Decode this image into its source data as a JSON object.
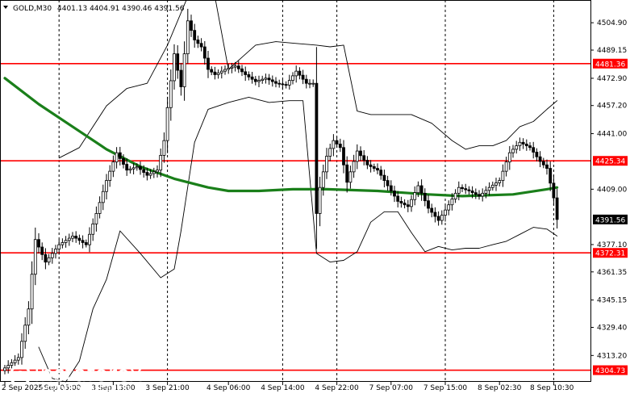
{
  "header": {
    "symbol": "GOLD,M30",
    "ohlc": "4401.13 4404.91 4390.46 4391.56"
  },
  "colors": {
    "background": "#ffffff",
    "candle": "#000000",
    "ma": "#1a7f1a",
    "envelope": "#000000",
    "level_line": "#ff0000",
    "level_tag_bg": "#ff0000",
    "level_tag_text": "#ffffff",
    "current_tag_bg": "#000000",
    "current_tag_text": "#ffffff",
    "grid_dashed": "#000000",
    "axis_text": "#000000"
  },
  "watermark": {
    "brand": "instaforex",
    "tagline": "Instant Forex Trading"
  },
  "chart_data": {
    "type": "candlestick",
    "title": "GOLD,M30",
    "ylim": [
      4298,
      4518
    ],
    "y_ticks": [
      4504.9,
      4489.15,
      4472.9,
      4457.2,
      4441.0,
      4409.0,
      4377.1,
      4361.35,
      4345.15,
      4329.4,
      4313.2
    ],
    "x_labels": [
      {
        "label": "2 Sep 2025",
        "index": 0
      },
      {
        "label": "3 Sep 05:00",
        "index": 16
      },
      {
        "label": "3 Sep 13:00",
        "index": 32
      },
      {
        "label": "3 Sep 21:00",
        "index": 48
      },
      {
        "label": "4 Sep 06:00",
        "index": 66
      },
      {
        "label": "4 Sep 14:00",
        "index": 82
      },
      {
        "label": "4 Sep 22:00",
        "index": 98
      },
      {
        "label": "7 Sep 07:00",
        "index": 114
      },
      {
        "label": "7 Sep 15:00",
        "index": 130
      },
      {
        "label": "8 Sep 02:30",
        "index": 146
      },
      {
        "label": "8 Sep 10:30",
        "index": 162
      }
    ],
    "vertical_grid_at_index": [
      16,
      48,
      82,
      98,
      130,
      162
    ],
    "price_levels": [
      {
        "value": 4481.36,
        "label": "4481.36"
      },
      {
        "value": 4425.34,
        "label": "4425.34"
      },
      {
        "value": 4372.31,
        "label": "4372.31"
      },
      {
        "value": 4304.73,
        "label": "4304.73"
      }
    ],
    "current_price": {
      "value": 4391.56,
      "label": "4391.56"
    },
    "close_anchors": [
      [
        0,
        4306
      ],
      [
        4,
        4312
      ],
      [
        7,
        4340
      ],
      [
        9,
        4380
      ],
      [
        12,
        4367
      ],
      [
        16,
        4377
      ],
      [
        20,
        4382
      ],
      [
        24,
        4377
      ],
      [
        27,
        4395
      ],
      [
        30,
        4414
      ],
      [
        33,
        4430
      ],
      [
        36,
        4420
      ],
      [
        39,
        4422
      ],
      [
        42,
        4417
      ],
      [
        45,
        4420
      ],
      [
        47,
        4437
      ],
      [
        48,
        4456
      ],
      [
        50,
        4487
      ],
      [
        52,
        4468
      ],
      [
        54,
        4506
      ],
      [
        56,
        4495
      ],
      [
        58,
        4491
      ],
      [
        60,
        4478
      ],
      [
        62,
        4475
      ],
      [
        65,
        4478
      ],
      [
        68,
        4480
      ],
      [
        71,
        4475
      ],
      [
        74,
        4471
      ],
      [
        77,
        4473
      ],
      [
        80,
        4470
      ],
      [
        83,
        4469
      ],
      [
        86,
        4477
      ],
      [
        89,
        4470
      ],
      [
        91,
        4470
      ],
      [
        92,
        4395
      ],
      [
        93,
        4410
      ],
      [
        95,
        4428
      ],
      [
        97,
        4437
      ],
      [
        99,
        4433
      ],
      [
        101,
        4413
      ],
      [
        104,
        4431
      ],
      [
        107,
        4423
      ],
      [
        110,
        4420
      ],
      [
        113,
        4411
      ],
      [
        116,
        4402
      ],
      [
        119,
        4399
      ],
      [
        122,
        4411
      ],
      [
        125,
        4398
      ],
      [
        128,
        4391
      ],
      [
        131,
        4400
      ],
      [
        134,
        4410
      ],
      [
        137,
        4408
      ],
      [
        140,
        4405
      ],
      [
        143,
        4410
      ],
      [
        146,
        4414
      ],
      [
        149,
        4430
      ],
      [
        152,
        4436
      ],
      [
        155,
        4433
      ],
      [
        158,
        4425
      ],
      [
        160,
        4421
      ],
      [
        162,
        4404
      ],
      [
        163,
        4391.56
      ]
    ],
    "ma_anchors": [
      [
        0,
        4473
      ],
      [
        10,
        4458
      ],
      [
        20,
        4445
      ],
      [
        30,
        4432
      ],
      [
        40,
        4422
      ],
      [
        50,
        4415
      ],
      [
        60,
        4410
      ],
      [
        66,
        4408
      ],
      [
        75,
        4408
      ],
      [
        85,
        4409
      ],
      [
        95,
        4409
      ],
      [
        110,
        4408
      ],
      [
        125,
        4406
      ],
      [
        135,
        4405
      ],
      [
        150,
        4406
      ],
      [
        160,
        4409
      ],
      [
        163,
        4410
      ]
    ],
    "upper_band_anchors": [
      [
        16,
        4427
      ],
      [
        22,
        4433
      ],
      [
        30,
        4457
      ],
      [
        36,
        4467
      ],
      [
        42,
        4470
      ],
      [
        48,
        4492
      ],
      [
        54,
        4520
      ],
      [
        58,
        4520
      ],
      [
        62,
        4520
      ],
      [
        66,
        4478
      ],
      [
        70,
        4485
      ],
      [
        74,
        4492
      ],
      [
        80,
        4494
      ],
      [
        86,
        4493
      ],
      [
        92,
        4492
      ],
      [
        96,
        4491
      ],
      [
        100,
        4492
      ],
      [
        104,
        4454
      ],
      [
        108,
        4452
      ],
      [
        114,
        4452
      ],
      [
        120,
        4452
      ],
      [
        126,
        4447
      ],
      [
        132,
        4437
      ],
      [
        136,
        4432
      ],
      [
        140,
        4434
      ],
      [
        144,
        4434
      ],
      [
        148,
        4437
      ],
      [
        152,
        4445
      ],
      [
        156,
        4448
      ],
      [
        160,
        4455
      ],
      [
        163,
        4460
      ]
    ],
    "lower_band_anchors": [
      [
        10,
        4318
      ],
      [
        14,
        4300
      ],
      [
        18,
        4298
      ],
      [
        22,
        4310
      ],
      [
        26,
        4340
      ],
      [
        30,
        4357
      ],
      [
        34,
        4385
      ],
      [
        40,
        4372
      ],
      [
        46,
        4358
      ],
      [
        50,
        4363
      ],
      [
        52,
        4385
      ],
      [
        56,
        4436
      ],
      [
        60,
        4455
      ],
      [
        66,
        4459
      ],
      [
        72,
        4462
      ],
      [
        78,
        4459
      ],
      [
        84,
        4460
      ],
      [
        88,
        4460
      ],
      [
        92,
        4372
      ],
      [
        96,
        4367
      ],
      [
        100,
        4368
      ],
      [
        104,
        4373
      ],
      [
        108,
        4390
      ],
      [
        112,
        4396
      ],
      [
        116,
        4396
      ],
      [
        120,
        4384
      ],
      [
        124,
        4373
      ],
      [
        128,
        4376
      ],
      [
        132,
        4374
      ],
      [
        136,
        4375
      ],
      [
        140,
        4375
      ],
      [
        144,
        4377
      ],
      [
        148,
        4379
      ],
      [
        152,
        4383
      ],
      [
        156,
        4387
      ],
      [
        160,
        4386
      ],
      [
        163,
        4382
      ]
    ]
  }
}
